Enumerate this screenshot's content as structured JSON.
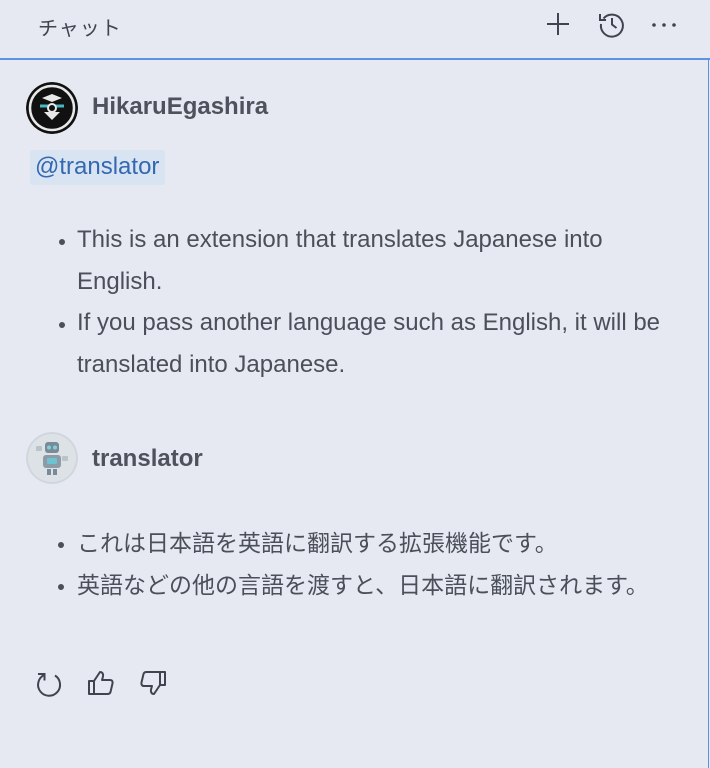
{
  "header": {
    "title": "チャット",
    "new_chat_icon": "plus-icon",
    "history_icon": "history-icon",
    "more_icon": "ellipsis-icon"
  },
  "messages": [
    {
      "sender": "HikaruEgashira",
      "mention": "@translator",
      "items": [
        "This is an extension that translates Japanese into English.",
        "If you pass another language such as English, it will be translated into Japanese."
      ]
    },
    {
      "sender": "translator",
      "items": [
        "これは日本語を英語に翻訳する拡張機能です。",
        "英語などの他の言語を渡すと、日本語に翻訳されます。"
      ]
    }
  ],
  "actions": {
    "retry_icon": "retry-icon",
    "thumbs_up_icon": "thumbs-up-icon",
    "thumbs_down_icon": "thumbs-down-icon"
  },
  "colors": {
    "background": "#e6e9f1",
    "accent_border": "#5d93e0",
    "mention_bg": "#d9e4f3",
    "mention_text": "#3468b0"
  }
}
